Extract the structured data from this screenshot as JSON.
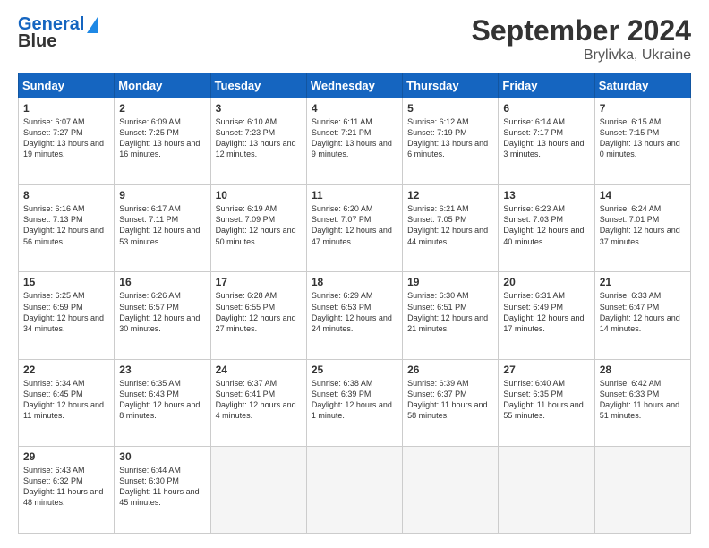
{
  "header": {
    "logo_line1": "General",
    "logo_line2": "Blue",
    "title": "September 2024",
    "subtitle": "Brylivka, Ukraine"
  },
  "calendar": {
    "days_header": [
      "Sunday",
      "Monday",
      "Tuesday",
      "Wednesday",
      "Thursday",
      "Friday",
      "Saturday"
    ],
    "weeks": [
      [
        {
          "day": "",
          "empty": true
        },
        {
          "day": "",
          "empty": true
        },
        {
          "day": "",
          "empty": true
        },
        {
          "day": "",
          "empty": true
        },
        {
          "day": "",
          "empty": true
        },
        {
          "day": "",
          "empty": true
        },
        {
          "day": "",
          "empty": true
        }
      ],
      [
        {
          "day": "1",
          "sunrise": "6:07 AM",
          "sunset": "7:27 PM",
          "daylight": "13 hours and 19 minutes."
        },
        {
          "day": "2",
          "sunrise": "6:09 AM",
          "sunset": "7:25 PM",
          "daylight": "13 hours and 16 minutes."
        },
        {
          "day": "3",
          "sunrise": "6:10 AM",
          "sunset": "7:23 PM",
          "daylight": "13 hours and 12 minutes."
        },
        {
          "day": "4",
          "sunrise": "6:11 AM",
          "sunset": "7:21 PM",
          "daylight": "13 hours and 9 minutes."
        },
        {
          "day": "5",
          "sunrise": "6:12 AM",
          "sunset": "7:19 PM",
          "daylight": "13 hours and 6 minutes."
        },
        {
          "day": "6",
          "sunrise": "6:14 AM",
          "sunset": "7:17 PM",
          "daylight": "13 hours and 3 minutes."
        },
        {
          "day": "7",
          "sunrise": "6:15 AM",
          "sunset": "7:15 PM",
          "daylight": "13 hours and 0 minutes."
        }
      ],
      [
        {
          "day": "8",
          "sunrise": "6:16 AM",
          "sunset": "7:13 PM",
          "daylight": "12 hours and 56 minutes."
        },
        {
          "day": "9",
          "sunrise": "6:17 AM",
          "sunset": "7:11 PM",
          "daylight": "12 hours and 53 minutes."
        },
        {
          "day": "10",
          "sunrise": "6:19 AM",
          "sunset": "7:09 PM",
          "daylight": "12 hours and 50 minutes."
        },
        {
          "day": "11",
          "sunrise": "6:20 AM",
          "sunset": "7:07 PM",
          "daylight": "12 hours and 47 minutes."
        },
        {
          "day": "12",
          "sunrise": "6:21 AM",
          "sunset": "7:05 PM",
          "daylight": "12 hours and 44 minutes."
        },
        {
          "day": "13",
          "sunrise": "6:23 AM",
          "sunset": "7:03 PM",
          "daylight": "12 hours and 40 minutes."
        },
        {
          "day": "14",
          "sunrise": "6:24 AM",
          "sunset": "7:01 PM",
          "daylight": "12 hours and 37 minutes."
        }
      ],
      [
        {
          "day": "15",
          "sunrise": "6:25 AM",
          "sunset": "6:59 PM",
          "daylight": "12 hours and 34 minutes."
        },
        {
          "day": "16",
          "sunrise": "6:26 AM",
          "sunset": "6:57 PM",
          "daylight": "12 hours and 30 minutes."
        },
        {
          "day": "17",
          "sunrise": "6:28 AM",
          "sunset": "6:55 PM",
          "daylight": "12 hours and 27 minutes."
        },
        {
          "day": "18",
          "sunrise": "6:29 AM",
          "sunset": "6:53 PM",
          "daylight": "12 hours and 24 minutes."
        },
        {
          "day": "19",
          "sunrise": "6:30 AM",
          "sunset": "6:51 PM",
          "daylight": "12 hours and 21 minutes."
        },
        {
          "day": "20",
          "sunrise": "6:31 AM",
          "sunset": "6:49 PM",
          "daylight": "12 hours and 17 minutes."
        },
        {
          "day": "21",
          "sunrise": "6:33 AM",
          "sunset": "6:47 PM",
          "daylight": "12 hours and 14 minutes."
        }
      ],
      [
        {
          "day": "22",
          "sunrise": "6:34 AM",
          "sunset": "6:45 PM",
          "daylight": "12 hours and 11 minutes."
        },
        {
          "day": "23",
          "sunrise": "6:35 AM",
          "sunset": "6:43 PM",
          "daylight": "12 hours and 8 minutes."
        },
        {
          "day": "24",
          "sunrise": "6:37 AM",
          "sunset": "6:41 PM",
          "daylight": "12 hours and 4 minutes."
        },
        {
          "day": "25",
          "sunrise": "6:38 AM",
          "sunset": "6:39 PM",
          "daylight": "12 hours and 1 minute."
        },
        {
          "day": "26",
          "sunrise": "6:39 AM",
          "sunset": "6:37 PM",
          "daylight": "11 hours and 58 minutes."
        },
        {
          "day": "27",
          "sunrise": "6:40 AM",
          "sunset": "6:35 PM",
          "daylight": "11 hours and 55 minutes."
        },
        {
          "day": "28",
          "sunrise": "6:42 AM",
          "sunset": "6:33 PM",
          "daylight": "11 hours and 51 minutes."
        }
      ],
      [
        {
          "day": "29",
          "sunrise": "6:43 AM",
          "sunset": "6:32 PM",
          "daylight": "11 hours and 48 minutes."
        },
        {
          "day": "30",
          "sunrise": "6:44 AM",
          "sunset": "6:30 PM",
          "daylight": "11 hours and 45 minutes."
        },
        {
          "day": "",
          "empty": true
        },
        {
          "day": "",
          "empty": true
        },
        {
          "day": "",
          "empty": true
        },
        {
          "day": "",
          "empty": true
        },
        {
          "day": "",
          "empty": true
        }
      ]
    ]
  }
}
